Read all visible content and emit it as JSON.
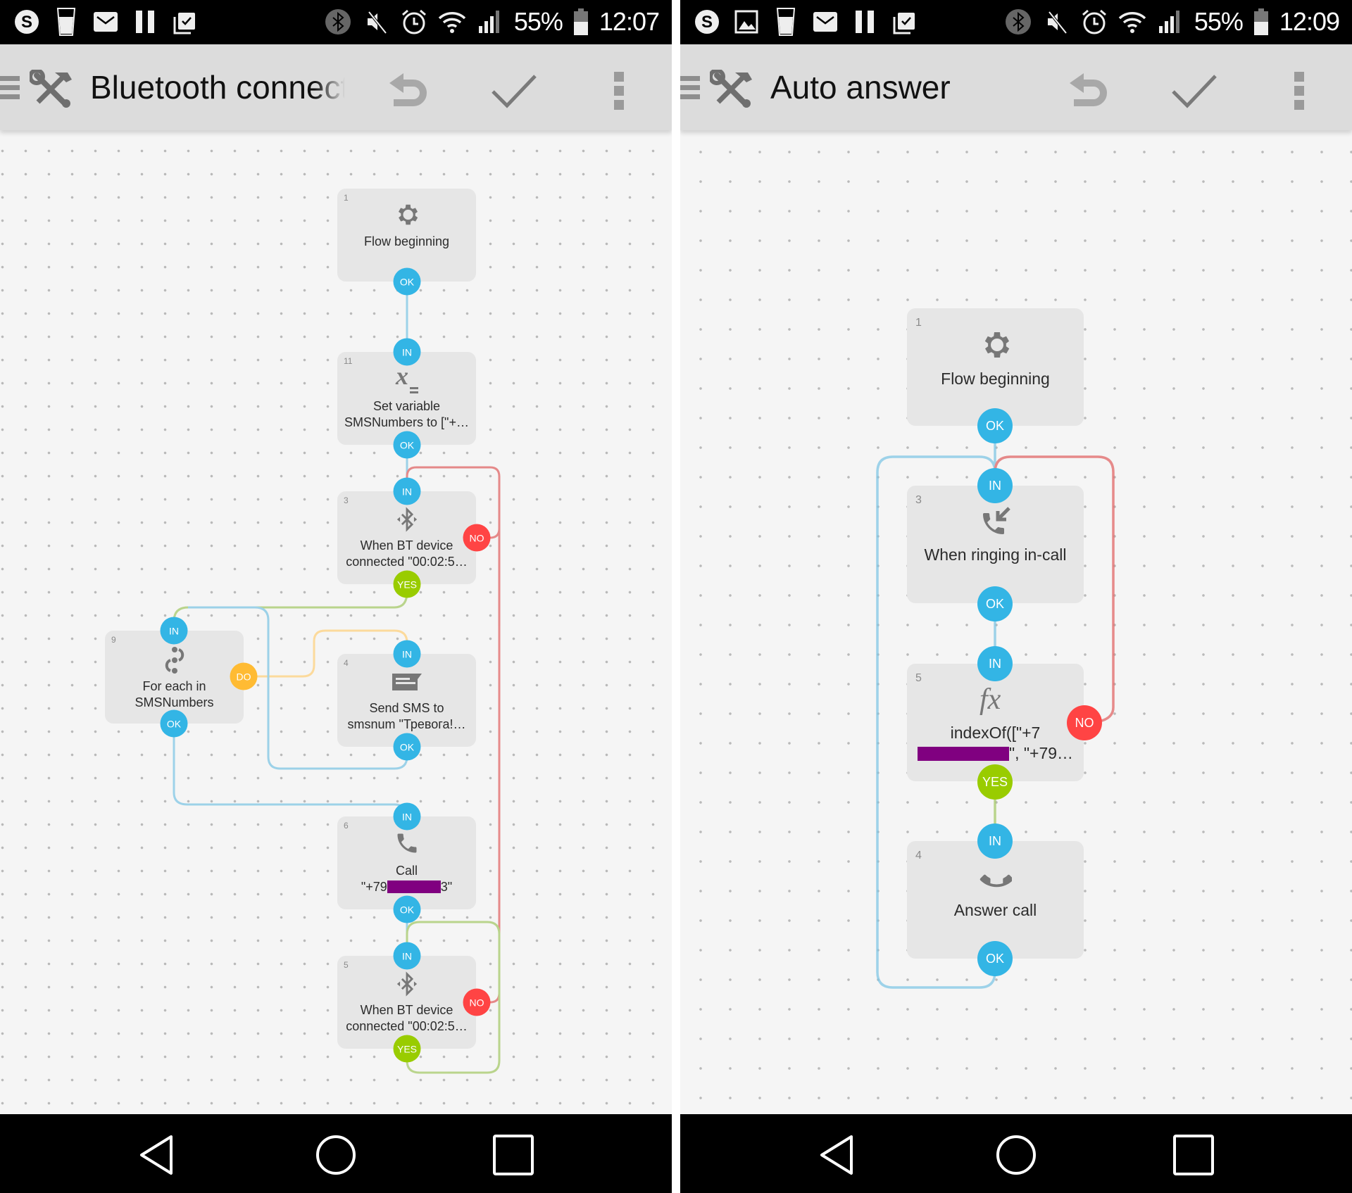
{
  "screens": [
    {
      "status_bar": {
        "notification_icons": [
          "skype-icon",
          "water-glass-icon",
          "mail-icon",
          "pause-icon",
          "clipboard-check-icon"
        ],
        "system_icons": [
          "bluetooth-icon",
          "mute-icon",
          "alarm-icon",
          "wifi-icon",
          "signal-icon"
        ],
        "battery": "55%",
        "time": "12:07"
      },
      "toolbar": {
        "title": "Bluetooth connected",
        "undo_label": "Undo",
        "save_label": "Save",
        "more_label": "More options"
      },
      "colors": {
        "ok": "#33b5e5",
        "no": "#ff4444",
        "yes": "#99cc00",
        "do": "#ffbb33"
      },
      "nodes": [
        {
          "id": "1",
          "icon": "gear-icon",
          "lines": [
            "Flow beginning"
          ],
          "ports": [
            "OK"
          ]
        },
        {
          "id": "11",
          "icon": "set-variable-icon",
          "lines": [
            "Set variable",
            "SMSNumbers to [\"+…"
          ],
          "ports": [
            "IN",
            "OK"
          ]
        },
        {
          "id": "3",
          "icon": "bluetooth-icon",
          "lines": [
            "When BT device",
            "connected \"00:02:5…"
          ],
          "ports": [
            "IN",
            "NO",
            "YES"
          ]
        },
        {
          "id": "9",
          "icon": "loop-icon",
          "lines": [
            "For each in",
            "SMSNumbers"
          ],
          "ports": [
            "IN",
            "DO",
            "OK"
          ]
        },
        {
          "id": "4",
          "icon": "sms-icon",
          "lines": [
            "Send SMS to",
            "smsnum \"Тревога!…"
          ],
          "ports": [
            "IN",
            "OK"
          ]
        },
        {
          "id": "6",
          "icon": "phone-icon",
          "lines": [
            "Call",
            "\"+79",
            "3\""
          ],
          "ports": [
            "IN",
            "OK"
          ]
        },
        {
          "id": "5",
          "icon": "bluetooth-icon",
          "lines": [
            "When BT device",
            "connected \"00:02:5…"
          ],
          "ports": [
            "IN",
            "NO",
            "YES"
          ]
        }
      ]
    },
    {
      "status_bar": {
        "notification_icons": [
          "skype-icon",
          "image-icon",
          "water-glass-icon",
          "mail-icon",
          "pause-icon",
          "clipboard-check-icon"
        ],
        "system_icons": [
          "bluetooth-icon",
          "mute-icon",
          "alarm-icon",
          "wifi-icon",
          "signal-icon"
        ],
        "battery": "55%",
        "time": "12:09"
      },
      "toolbar": {
        "title": "Auto answer",
        "undo_label": "Undo",
        "save_label": "Save",
        "more_label": "More options"
      },
      "nodes": [
        {
          "id": "1",
          "icon": "gear-icon",
          "lines": [
            "Flow beginning"
          ],
          "ports": [
            "OK"
          ]
        },
        {
          "id": "3",
          "icon": "incoming-call-icon",
          "lines": [
            "When ringing in-call"
          ],
          "ports": [
            "IN",
            "OK"
          ]
        },
        {
          "id": "5",
          "icon": "function-icon",
          "lines": [
            "indexOf([\"+7",
            "\", \"+79…"
          ],
          "ports": [
            "IN",
            "NO",
            "YES"
          ]
        },
        {
          "id": "4",
          "icon": "answer-call-icon",
          "lines": [
            "Answer call"
          ],
          "ports": [
            "IN",
            "OK"
          ]
        }
      ]
    }
  ],
  "navigation_bar": {
    "back_label": "Back",
    "home_label": "Home",
    "recents_label": "Recents"
  }
}
